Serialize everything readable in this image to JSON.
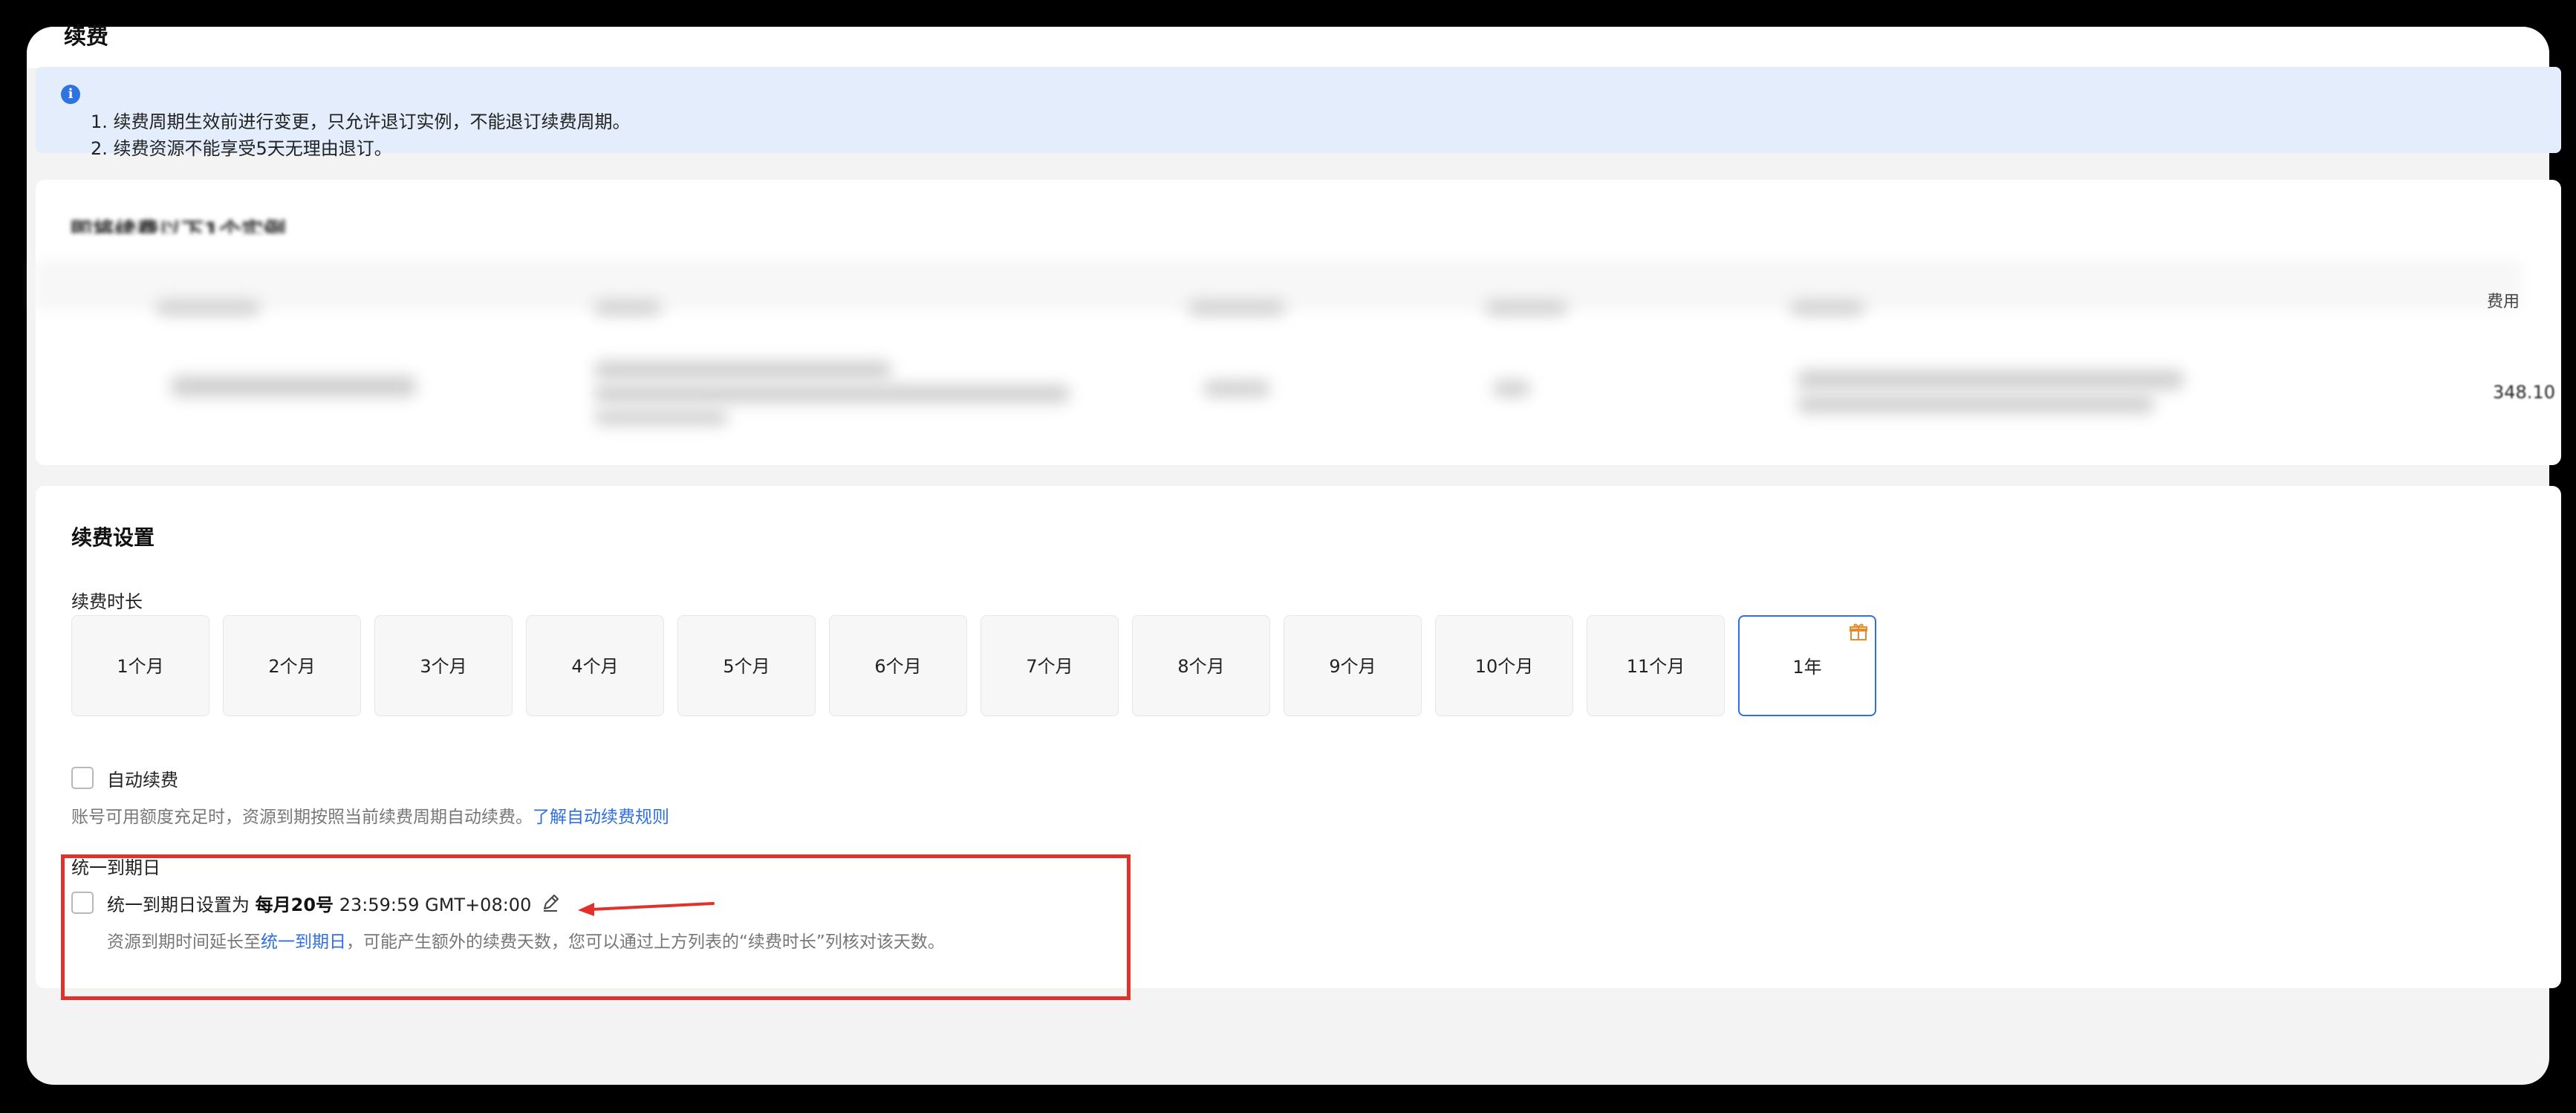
{
  "page": {
    "title": "续费"
  },
  "notice": {
    "lines": [
      "1. 续费周期生效前进行变更，只允许退订实例，不能退订续费周期。",
      "2. 续费资源不能享受5天无理由退订。"
    ]
  },
  "instances": {
    "title": "即将续费以下1个实例",
    "fee_header": "费用",
    "fee_value": "348.10"
  },
  "settings": {
    "title": "续费设置",
    "duration_label": "续费时长",
    "options": [
      "1个月",
      "2个月",
      "3个月",
      "4个月",
      "5个月",
      "6个月",
      "7个月",
      "8个月",
      "9个月",
      "10个月",
      "11个月",
      "1年"
    ],
    "selected": "1年",
    "auto_renew": {
      "label": "自动续费",
      "checked": false,
      "desc": "账号可用额度充足时，资源到期按照当前续费周期自动续费。",
      "link": "了解自动续费规则"
    },
    "unify": {
      "title": "统一到期日",
      "checked": false,
      "label_prefix": "统一到期日设置为",
      "date": "每月20号",
      "time": "23:59:59 GMT+08:00",
      "desc_prefix": "资源到期时间延长至",
      "desc_link": "统一到期日",
      "desc_suffix": "，可能产生额外的续费天数，您可以通过上方列表的“续费时长”列核对该天数。"
    }
  },
  "colors": {
    "accent": "#2f6fe0",
    "highlight": "#e0322a",
    "notice_bg": "#e3edfb"
  }
}
